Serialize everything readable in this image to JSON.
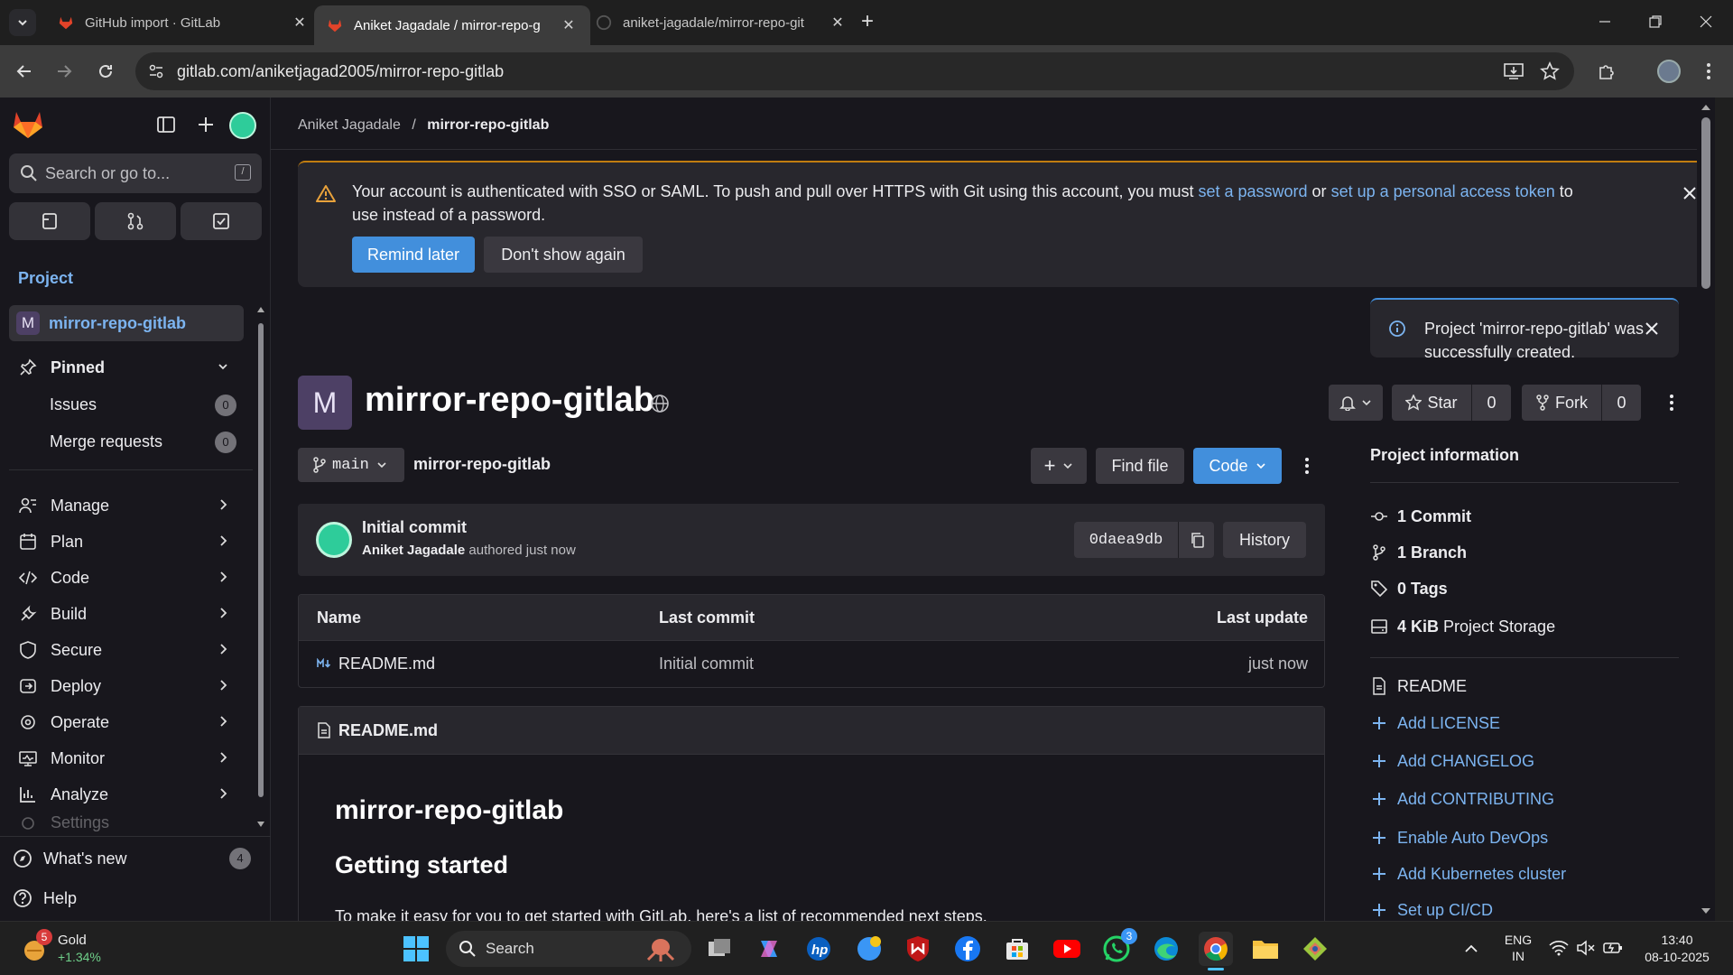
{
  "browser": {
    "tabs": [
      {
        "title": "GitHub import · GitLab",
        "active": false
      },
      {
        "title": "Aniket Jagadale / mirror-repo-g",
        "active": true
      },
      {
        "title": "aniket-jagadale/mirror-repo-git",
        "active": false
      }
    ],
    "url": "gitlab.com/aniketjagad2005/mirror-repo-gitlab"
  },
  "sidebar": {
    "search_placeholder": "Search or go to...",
    "kbd_hint": "/",
    "section_heading": "Project",
    "project": {
      "avatar_letter": "M",
      "name": "mirror-repo-gitlab"
    },
    "pinned": {
      "label": "Pinned",
      "items": [
        {
          "label": "Issues",
          "count": "0"
        },
        {
          "label": "Merge requests",
          "count": "0"
        }
      ]
    },
    "nav": [
      {
        "label": "Manage",
        "icon": "manage-icon"
      },
      {
        "label": "Plan",
        "icon": "plan-icon"
      },
      {
        "label": "Code",
        "icon": "code-icon"
      },
      {
        "label": "Build",
        "icon": "build-icon"
      },
      {
        "label": "Secure",
        "icon": "shield-icon"
      },
      {
        "label": "Deploy",
        "icon": "deploy-icon"
      },
      {
        "label": "Operate",
        "icon": "operate-icon"
      },
      {
        "label": "Monitor",
        "icon": "monitor-icon"
      },
      {
        "label": "Analyze",
        "icon": "analyze-icon"
      },
      {
        "label": "Settings",
        "icon": "settings-icon"
      }
    ],
    "whats_new": {
      "label": "What's new",
      "count": "4"
    },
    "help": "Help"
  },
  "main": {
    "breadcrumb": {
      "owner": "Aniket Jagadale",
      "separator": "/",
      "project": "mirror-repo-gitlab"
    },
    "sso_alert": {
      "text_before": "Your account is authenticated with SSO or SAML. To push and pull over HTTPS with Git using this account, you must ",
      "link1": "set a password",
      "text_or": " or ",
      "link2": "set up a personal access token",
      "text_after": " to",
      "line2": "use instead of a password.",
      "remind_label": "Remind later",
      "dismiss_label": "Don't show again"
    },
    "success_alert": {
      "text": "Project 'mirror-repo-gitlab' was successfully created."
    },
    "project": {
      "avatar_letter": "M",
      "title": "mirror-repo-gitlab",
      "star_label": "Star",
      "star_count": "0",
      "fork_label": "Fork",
      "fork_count": "0"
    },
    "repo_bar": {
      "branch": "main",
      "path": "mirror-repo-gitlab",
      "add_label": "+",
      "find_file_label": "Find file",
      "code_label": "Code"
    },
    "last_commit": {
      "title": "Initial commit",
      "author": "Aniket Jagadale",
      "meta": "authored just now",
      "sha": "0daea9db",
      "history_label": "History"
    },
    "files_table": {
      "headers": {
        "name": "Name",
        "last_commit": "Last commit",
        "last_update": "Last update"
      },
      "rows": [
        {
          "name": "README.md",
          "last_commit": "Initial commit",
          "last_update": "just now"
        }
      ]
    },
    "readme": {
      "filename": "README.md",
      "h1": "mirror-repo-gitlab",
      "h2": "Getting started",
      "p": "To make it easy for you to get started with GitLab, here's a list of recommended next steps."
    },
    "project_info": {
      "heading": "Project information",
      "stats": [
        {
          "value": "1",
          "label": "Commit"
        },
        {
          "value": "1",
          "label": "Branch"
        },
        {
          "value": "0",
          "label": "Tags"
        },
        {
          "value": "4 KiB",
          "label": "Project Storage"
        }
      ],
      "links": [
        "README",
        "Add LICENSE",
        "Add CHANGELOG",
        "Add CONTRIBUTING",
        "Enable Auto DevOps",
        "Add Kubernetes cluster",
        "Set up CI/CD"
      ]
    }
  },
  "taskbar": {
    "weather": {
      "label": "Gold",
      "change": "+1.34%",
      "badge": "5"
    },
    "search_label": "Search",
    "whatsapp_badge": "3",
    "lang": "ENG",
    "region": "IN",
    "time": "13:40",
    "date": "08-10-2025"
  }
}
